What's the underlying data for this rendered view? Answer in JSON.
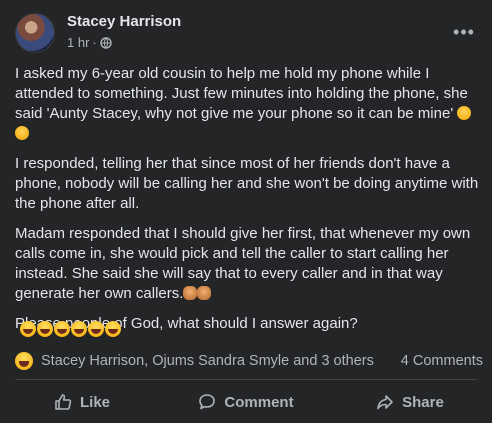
{
  "post": {
    "author": "Stacey Harrison",
    "time": "1 hr",
    "separator": "·",
    "more_icon": "ellipsis-icon",
    "paragraphs": [
      "I asked my 6-year old cousin to help me hold my phone while I attended to something. Just few minutes into holding the phone, she said 'Aunty Stacey,  why not give me your phone so it can be mine'",
      "I responded,  telling her that since most of her friends don't have a phone, nobody will be calling her and she won't be doing anytime with the phone after all.",
      "Madam responded that I should give her first,  that whenever my own calls come in, she would pick and tell the caller to start calling her instead. She said she will say that to every caller and in that way generate her own callers.",
      "Please people of God, what should I answer again?"
    ],
    "laugh_emoji_count": 6
  },
  "reactions": {
    "summary": "Stacey Harrison, Ojums Sandra Smyle and 3 others",
    "comments": "4 Comments"
  },
  "actions": {
    "like": "Like",
    "comment": "Comment",
    "share": "Share"
  },
  "colors": {
    "background": "#242526",
    "text": "#e4e6eb",
    "secondary": "#b0b3b8"
  }
}
